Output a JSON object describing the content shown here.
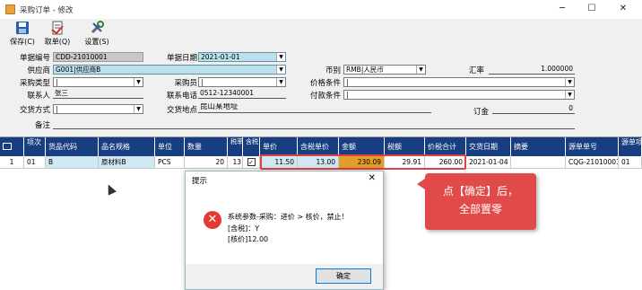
{
  "window": {
    "title": "采购订单 - 修改"
  },
  "toolbar": {
    "save": "保存(C)",
    "fetch": "取单(Q)",
    "settings": "设置(S)"
  },
  "form": {
    "order_no_label": "单据编号",
    "order_no": "CDD-21010001",
    "order_date_label": "单据日期",
    "order_date": "2021-01-01",
    "supplier_label": "供应商",
    "supplier": "G001|供应商B",
    "currency_label": "币别",
    "currency": "RMB|人民币",
    "rate_label": "汇率",
    "rate": "1.000000",
    "purchase_type_label": "采购类型",
    "purchase_type": "|",
    "buyer_label": "采购员",
    "buyer": "|",
    "price_cond_label": "价格条件",
    "price_cond": "|",
    "contact_label": "联系人",
    "contact": "张三",
    "phone_label": "联系电话",
    "phone": "0512-12340001",
    "payment_label": "付款条件",
    "payment": "|",
    "delivery_method_label": "交货方式",
    "delivery_method": "|",
    "delivery_place_label": "交货地点",
    "delivery_place": "昆山某地址",
    "deposit_label": "订金",
    "deposit": "0",
    "remark_label": "备注",
    "remark": ""
  },
  "grid": {
    "headers": {
      "idx": "项次",
      "code": "货品代码",
      "name": "品名规格",
      "unit": "单位",
      "qty": "数量",
      "taxrate": "税率",
      "taxinc": "含税",
      "price": "单价",
      "taxprice": "含税单价",
      "amount": "金额",
      "tax": "税额",
      "total": "价税合计",
      "delivery": "交货日期",
      "summary": "摘要",
      "srcno": "源单单号",
      "srcidx": "源单项次"
    },
    "row": {
      "num": "1",
      "idx": "01",
      "code": "B",
      "name": "原材料B",
      "unit": "PCS",
      "qty": "20",
      "taxrate": "13",
      "price": "11.50",
      "taxprice": "13.00",
      "amount": "230.09",
      "tax": "29.91",
      "total": "260.00",
      "delivery": "2021-01-04",
      "summary": "",
      "srcno": "CQG-21010001",
      "srcidx": "01"
    }
  },
  "callout": {
    "line1": "点【确定】后，",
    "line2": "全部置零"
  },
  "dialog": {
    "title": "提示",
    "line1": "系统参数-采购：进价 > 核价，禁止！",
    "line2": "[含税]：Y",
    "line3": "[核价]12.00",
    "ok": "确定"
  },
  "colors": {
    "header_bg": "#163e80",
    "highlight_blue": "#cfe8f3",
    "highlight_orange": "#e39e2a",
    "annotation_red": "#e04a48"
  },
  "icons": {
    "save": "floppy-disk-icon",
    "fetch": "document-fetch-icon",
    "settings": "tools-icon",
    "error": "error-x-icon"
  }
}
